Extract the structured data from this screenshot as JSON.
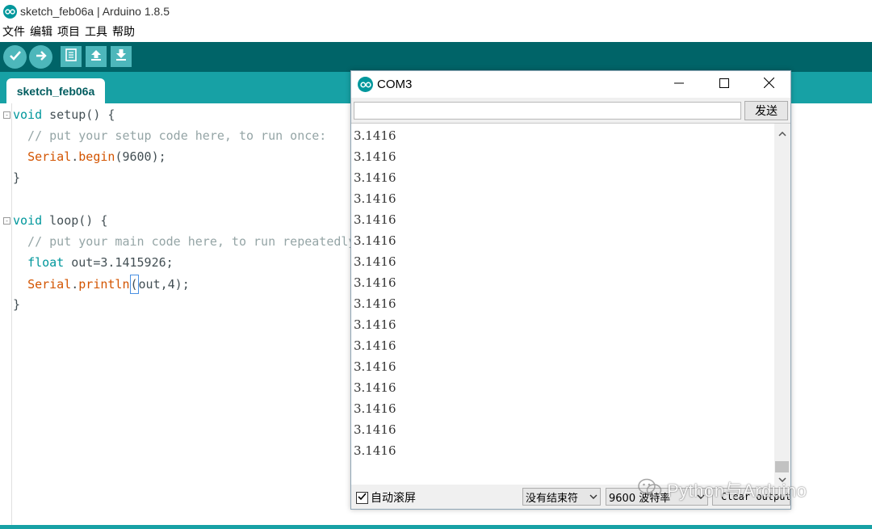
{
  "app": {
    "title": "sketch_feb06a | Arduino 1.8.5",
    "menu": [
      "文件",
      "编辑",
      "项目",
      "工具",
      "帮助"
    ],
    "toolbar": {
      "verify_icon": "check-icon",
      "upload_icon": "arrow-right-icon",
      "new_icon": "document-icon",
      "open_icon": "arrow-up-icon",
      "save_icon": "arrow-down-icon"
    },
    "tab_label": "sketch_feb06a",
    "colors": {
      "toolbar": "#006468",
      "tabbar": "#17a1a5",
      "keyword": "#00979c",
      "function": "#d35400",
      "comment": "#95a5a6"
    }
  },
  "code": {
    "line1_kw": "void",
    "line1_rest": " setup() {",
    "line2": "  // put your setup code here, to run once:",
    "line3_obj": "Serial",
    "line3_dot": ".",
    "line3_fn": "begin",
    "line3_rest": "(9600);",
    "line4": "}",
    "line6_kw": "void",
    "line6_rest": " loop() {",
    "line7": "  // put your main code here, to run repeatedly:",
    "line8_kw": "float",
    "line8_rest": " out=3.1415926;",
    "line9_obj": "Serial",
    "line9_dot": ".",
    "line9_fn": "println",
    "line9_paren": "(",
    "line9_rest": "out,4);",
    "line10": "}"
  },
  "serial_monitor": {
    "title": "COM3",
    "send_label": "发送",
    "input_value": "",
    "output_lines": [
      "3.1416",
      "3.1416",
      "3.1416",
      "3.1416",
      "3.1416",
      "3.1416",
      "3.1416",
      "3.1416",
      "3.1416",
      "3.1416",
      "3.1416",
      "3.1416",
      "3.1416",
      "3.1416",
      "3.1416",
      "3.1416"
    ],
    "autoscroll_label": "自动滚屏",
    "autoscroll_checked": true,
    "line_ending": "没有结束符",
    "baud_rate": "9600 波特率",
    "clear_label": "Clear output"
  },
  "watermark": {
    "text": "Python与Arduino"
  }
}
